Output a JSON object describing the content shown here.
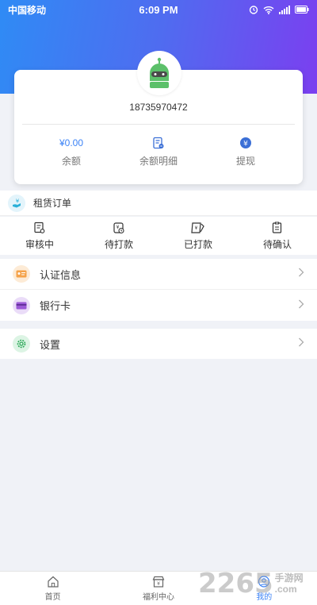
{
  "status_bar": {
    "carrier": "中国移动",
    "time": "6:09 PM",
    "icons": [
      "alarm-icon",
      "wifi-icon",
      "signal-icon",
      "battery-icon"
    ]
  },
  "profile": {
    "phone": "18735970472",
    "balance_value": "¥0.00",
    "balance_label": "余额",
    "detail_label": "余额明细",
    "withdraw_label": "提现"
  },
  "rental": {
    "title": "租赁订单",
    "statuses": [
      {
        "label": "审核中",
        "icon": "review-icon"
      },
      {
        "label": "待打款",
        "icon": "pending-payment-icon"
      },
      {
        "label": "已打款",
        "icon": "paid-icon"
      },
      {
        "label": "待确认",
        "icon": "to-confirm-icon"
      }
    ]
  },
  "menu": {
    "items": [
      {
        "label": "认证信息",
        "icon": "id-card-icon"
      },
      {
        "label": "银行卡",
        "icon": "bank-card-icon"
      }
    ],
    "settings_label": "设置"
  },
  "tabbar": {
    "tabs": [
      {
        "label": "首页"
      },
      {
        "label": "福利中心"
      },
      {
        "label": "我的"
      }
    ],
    "active": "我的"
  },
  "watermark": {
    "number": "2265",
    "line1": "手游网",
    "line2": ".com"
  },
  "colors": {
    "accent": "#3b82f6",
    "gradient_start": "#2f8bf5",
    "gradient_end": "#7b3ff0",
    "robot_green": "#5cc06a"
  }
}
